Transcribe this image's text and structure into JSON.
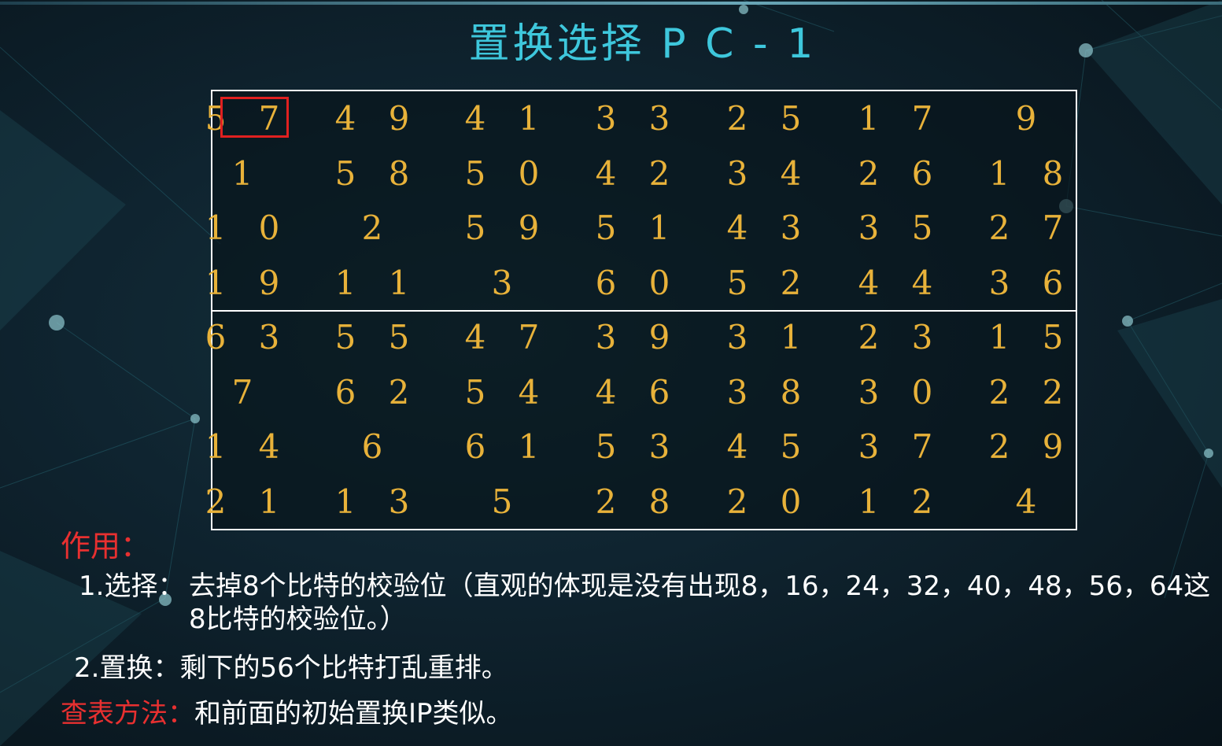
{
  "title": "置换选择 P C - 1",
  "table": {
    "top_rows": [
      [
        "5 7",
        "4 9",
        "4 1",
        "3 3",
        "2 5",
        "1 7",
        "9"
      ],
      [
        "1",
        "5 8",
        "5 0",
        "4 2",
        "3 4",
        "2 6",
        "1 8"
      ],
      [
        "1 0",
        "2",
        "5 9",
        "5 1",
        "4 3",
        "3 5",
        "2 7"
      ],
      [
        "1 9",
        "1 1",
        "3",
        "6 0",
        "5 2",
        "4 4",
        "3 6"
      ]
    ],
    "bottom_rows": [
      [
        "6 3",
        "5 5",
        "4 7",
        "3 9",
        "3 1",
        "2 3",
        "1 5"
      ],
      [
        "7",
        "6 2",
        "5 4",
        "4 6",
        "3 8",
        "3 0",
        "2 2"
      ],
      [
        "1 4",
        "6",
        "6 1",
        "5 3",
        "4 5",
        "3 7",
        "2 9"
      ],
      [
        "2 1",
        "1 3",
        "5",
        "2 8",
        "2 0",
        "1 2",
        "4"
      ]
    ],
    "highlight_color": "#e02020",
    "number_color": "#e8b23a"
  },
  "notes": {
    "role_label": "作用：",
    "item1_number": "1.选择：",
    "item1_text": "去掉8个比特的校验位（直观的体现是没有出现8，16，24，32，40，48，56，64这8比特的校验位。）",
    "item2_text": "2.置换：剩下的56个比特打乱重排。",
    "lookup_label": "查表方法：",
    "lookup_text": "和前面的初始置换IP类似。"
  }
}
